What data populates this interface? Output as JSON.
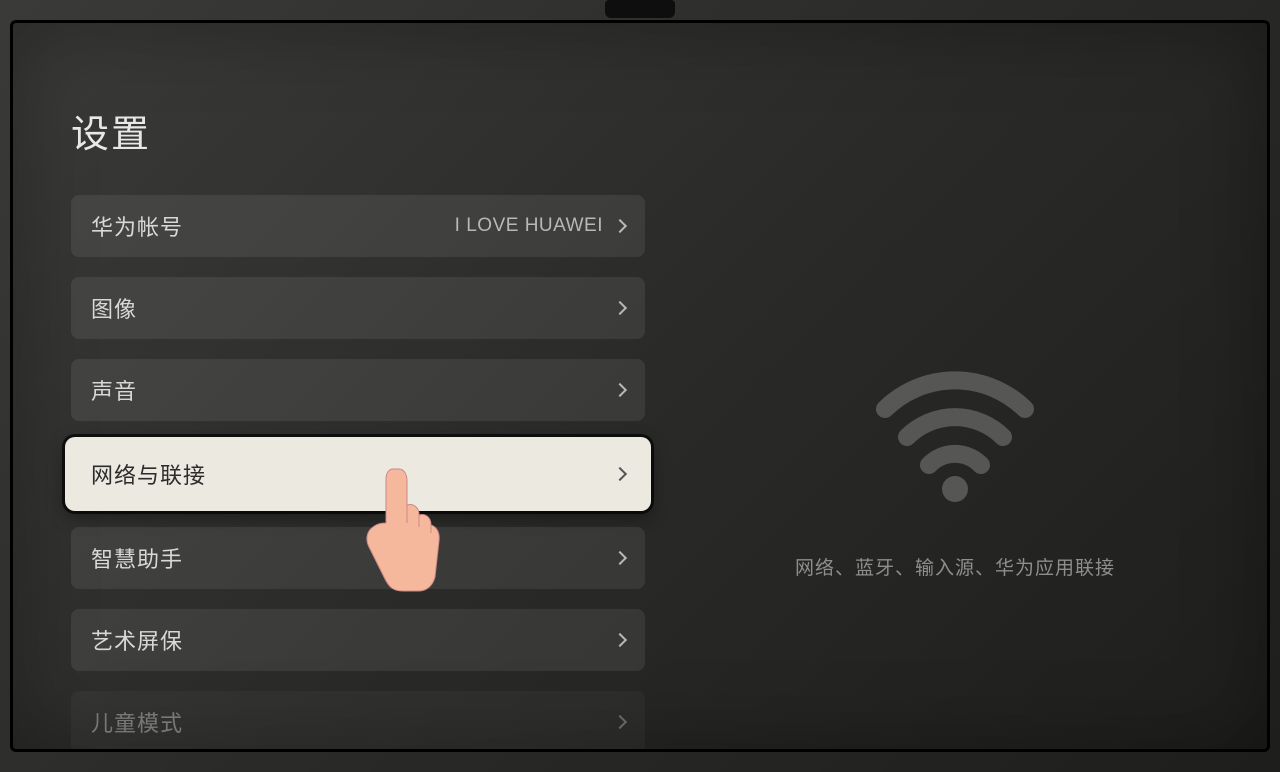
{
  "title": "设置",
  "menu": {
    "items": [
      {
        "label": "华为帐号",
        "value": "I LOVE HUAWEI"
      },
      {
        "label": "图像"
      },
      {
        "label": "声音"
      },
      {
        "label": "网络与联接"
      },
      {
        "label": "智慧助手"
      },
      {
        "label": "艺术屏保"
      },
      {
        "label": "儿童模式"
      }
    ]
  },
  "detail": {
    "icon": "wifi-icon",
    "desc": "网络、蓝牙、输入源、华为应用联接"
  }
}
